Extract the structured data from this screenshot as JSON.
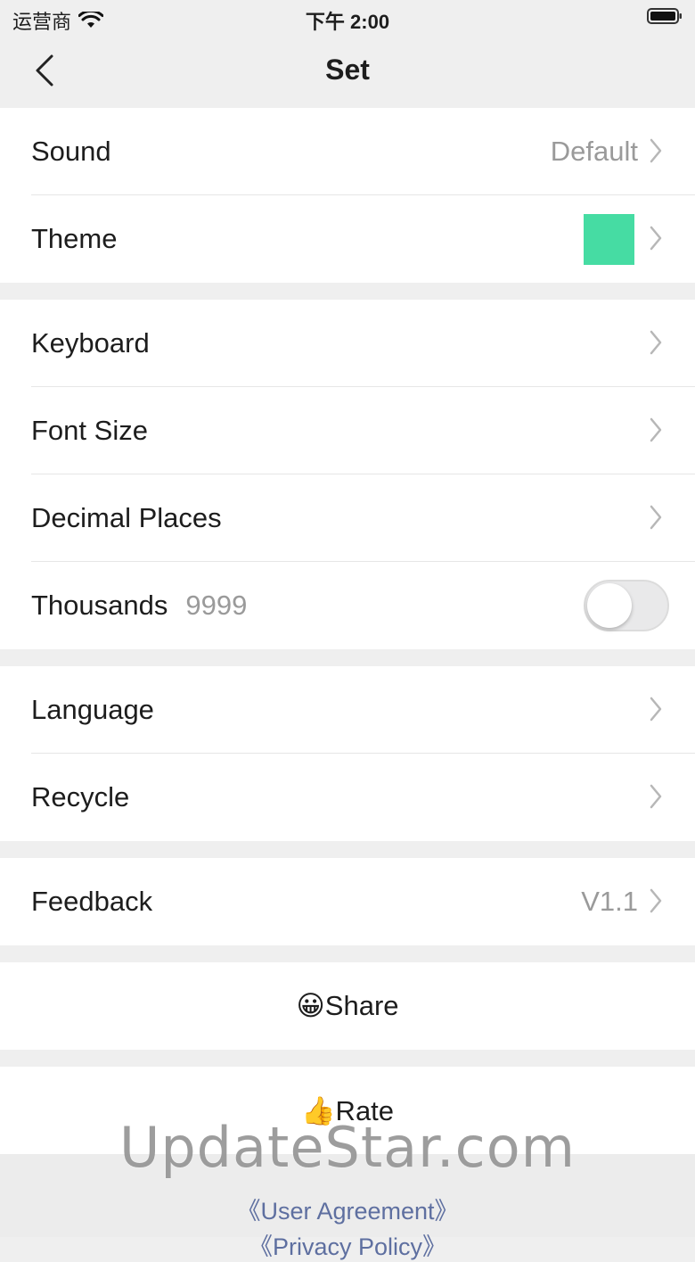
{
  "status": {
    "carrier": "运营商",
    "time": "下午 2:00"
  },
  "nav": {
    "title": "Set"
  },
  "groups": {
    "g1": [
      {
        "label": "Sound",
        "value": "Default"
      },
      {
        "label": "Theme",
        "swatch_color": "#46dca3"
      }
    ],
    "g2": [
      {
        "label": "Keyboard"
      },
      {
        "label": "Font Size"
      },
      {
        "label": "Decimal Places"
      },
      {
        "label": "Thousands",
        "sub": "9999",
        "toggle_on": false
      }
    ],
    "g3": [
      {
        "label": "Language"
      },
      {
        "label": "Recycle"
      }
    ],
    "g4": [
      {
        "label": "Feedback",
        "value": "V1.1"
      }
    ]
  },
  "actions": {
    "share": "😀Share",
    "rate": "👍Rate"
  },
  "footer": {
    "user_agreement": "《User Agreement》",
    "privacy_policy": "《Privacy Policy》"
  },
  "watermark": "UpdateStar.com",
  "colors": {
    "background": "#efefef",
    "accent_swatch": "#46dca3",
    "link": "#5e6fa0"
  }
}
